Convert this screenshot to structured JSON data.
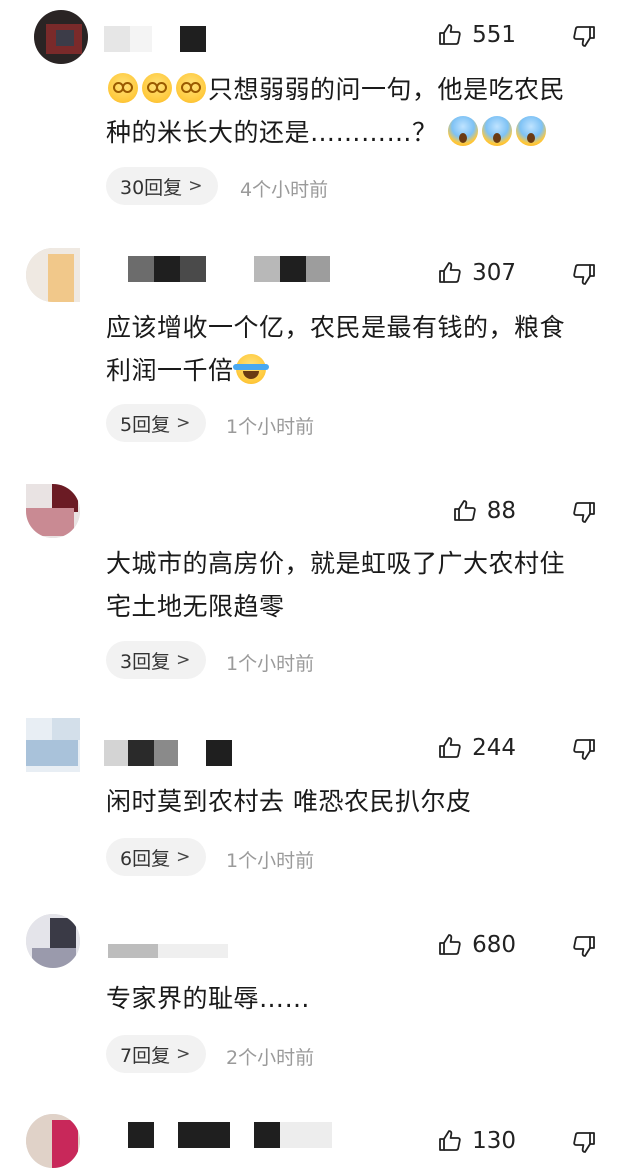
{
  "comments": [
    {
      "likes": "551",
      "text_line1": "只想弱弱的问一句，他是吃农民",
      "text_line2": "种的米长大的还是…………？",
      "replies": "30回复",
      "time": "4个小时前"
    },
    {
      "likes": "307",
      "text_line1": "应该增收一个亿，农民是最有钱的，粮食",
      "text_line2": "利润一千倍",
      "replies": "5回复",
      "time": "1个小时前"
    },
    {
      "likes": "88",
      "text_line1": "大城市的高房价，就是虹吸了广大农村住",
      "text_line2": "宅土地无限趋零",
      "replies": "3回复",
      "time": "1个小时前"
    },
    {
      "likes": "244",
      "text_line1": "闲时莫到农村去 唯恐农民扒尔皮",
      "replies": "6回复",
      "time": "1个小时前"
    },
    {
      "likes": "680",
      "text_line1": "专家界的耻辱……",
      "replies": "7回复",
      "time": "2个小时前"
    },
    {
      "likes": "130"
    }
  ],
  "icons": {
    "like": "thumbs-up-icon",
    "dislike": "thumbs-down-icon",
    "reply_chevron": ">"
  }
}
